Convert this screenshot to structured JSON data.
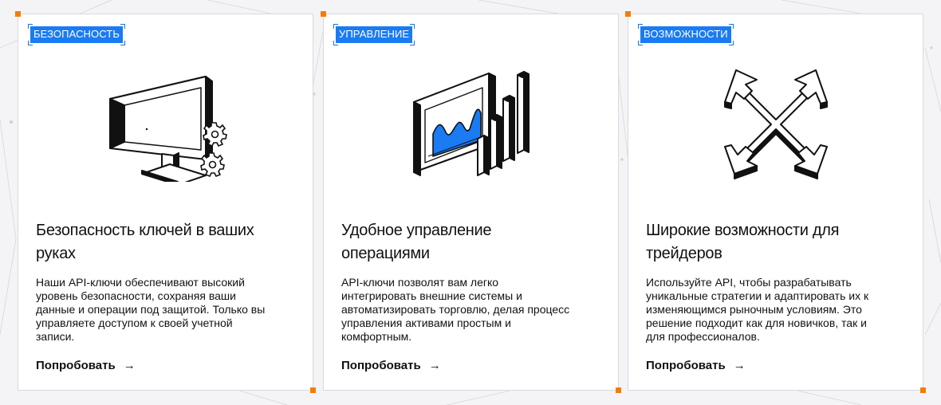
{
  "colors": {
    "accent": "#1a7bf2",
    "corner": "#f57c00",
    "bracket": "#1976d2"
  },
  "cards": [
    {
      "tag": "БЕЗОПАСНОСТЬ",
      "title_line1": "Безопасность ключей в ваших",
      "title_line2": "руках",
      "desc": [
        "Наши API-ключи обеспечивают высокий",
        "уровень безопасности, сохраняя ваши",
        "данные и операции под защитой. Только вы",
        "управляете доступом к своей учетной",
        "записи."
      ],
      "cta": "Попробовать",
      "arrow": "→",
      "icon": "monitor-gears-icon"
    },
    {
      "tag": "УПРАВЛЕНИЕ",
      "title_line1": "Удобное управление",
      "title_line2": "операциями",
      "desc": [
        "API-ключи позволят вам легко",
        "интегрировать внешние системы и",
        "автоматизировать торговлю, делая процесс",
        "управления активами простым и",
        "комфортным."
      ],
      "cta": "Попробовать",
      "arrow": "→",
      "icon": "monitor-chart-icon"
    },
    {
      "tag": "ВОЗМОЖНОСТИ",
      "title_line1": "Широкие возможности для",
      "title_line2": "трейдеров",
      "desc": [
        "Используйте API, чтобы разрабатывать",
        "уникальные стратегии и адаптировать их к",
        "изменяющимся рыночным условиям. Это",
        "решение подходит как для новичков, так и",
        "для профессионалов."
      ],
      "cta": "Попробовать",
      "arrow": "→",
      "icon": "expand-arrows-icon"
    }
  ]
}
